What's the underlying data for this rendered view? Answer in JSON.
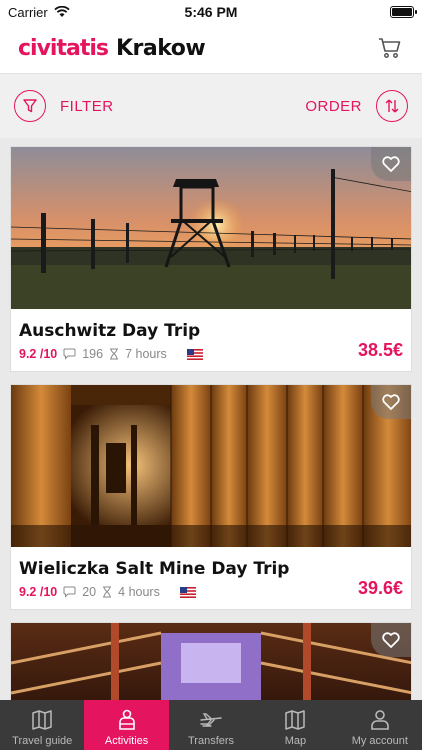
{
  "status_bar": {
    "carrier": "Carrier",
    "time": "5:46 PM"
  },
  "header": {
    "brand": "civitatis",
    "city": "Krakow"
  },
  "filter_bar": {
    "filter_label": "FILTER",
    "order_label": "ORDER"
  },
  "activities": [
    {
      "title": "Auschwitz Day Trip",
      "rating": "9.2 /10",
      "reviews": "196",
      "duration": "7 hours",
      "price": "38.5€"
    },
    {
      "title": "Wieliczka Salt Mine Day Trip",
      "rating": "9.2 /10",
      "reviews": "20",
      "duration": "4 hours",
      "price": "39.6€"
    }
  ],
  "tabs": [
    {
      "label": "Travel guide",
      "icon": "map-book-icon",
      "active": false
    },
    {
      "label": "Activities",
      "icon": "person-icon",
      "active": true
    },
    {
      "label": "Transfers",
      "icon": "plane-icon",
      "active": false
    },
    {
      "label": "Map",
      "icon": "map-icon",
      "active": false
    },
    {
      "label": "My account",
      "icon": "user-icon",
      "active": false
    }
  ],
  "colors": {
    "accent": "#e4145f",
    "tabbar": "#3a3a3a"
  }
}
